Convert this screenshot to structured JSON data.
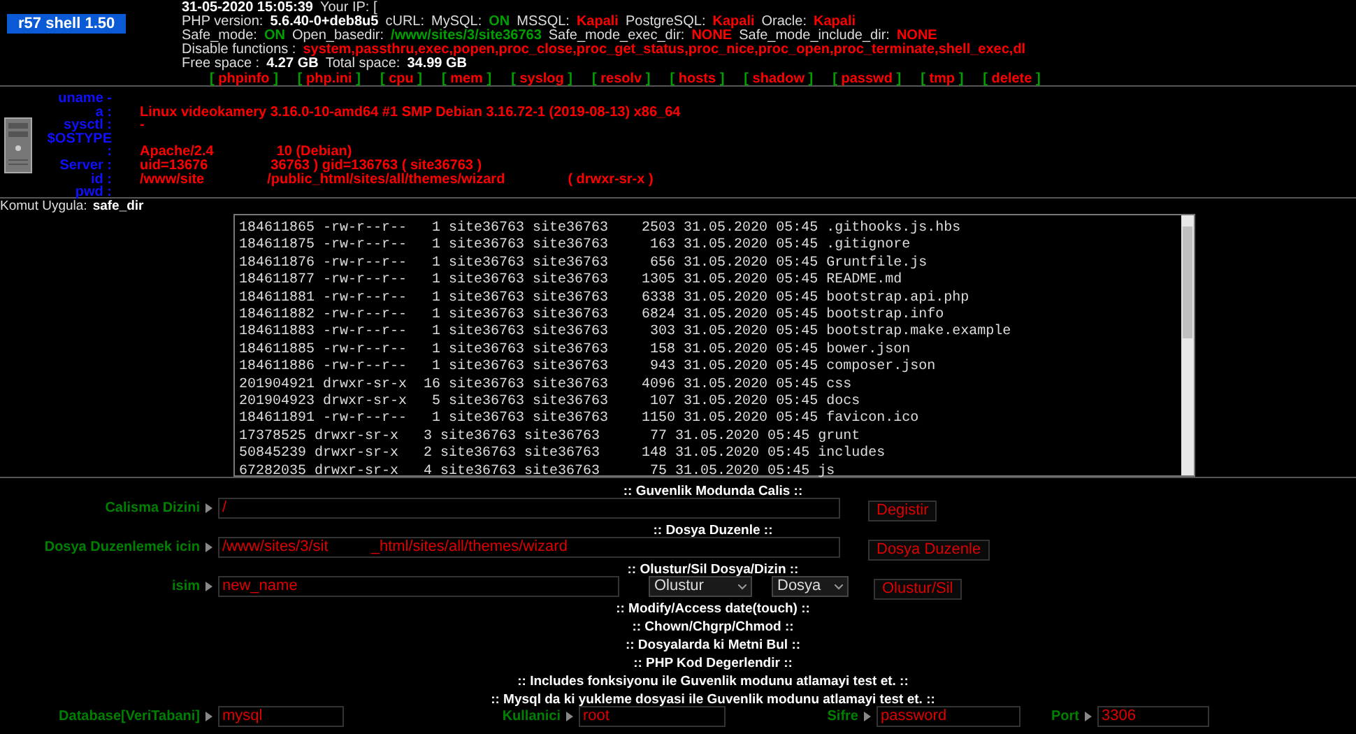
{
  "header": {
    "title": "r57 shell 1.50",
    "info_lines": [
      [
        {
          "text": "31-05-2020 15:05:39",
          "kind": "strong"
        },
        {
          "text": "Your IP: [",
          "kind": "label"
        }
      ],
      [
        {
          "text": "PHP version:",
          "kind": "label"
        },
        {
          "text": "5.6.40-0+deb8u5",
          "kind": "strong"
        },
        {
          "text": "cURL:",
          "kind": "label"
        },
        {
          "text": "MySQL:",
          "kind": "label"
        },
        {
          "text": "ON",
          "kind": "on"
        },
        {
          "text": "MSSQL:",
          "kind": "label"
        },
        {
          "text": "Kapali",
          "kind": "off"
        },
        {
          "text": "PostgreSQL:",
          "kind": "label"
        },
        {
          "text": "Kapali",
          "kind": "off"
        },
        {
          "text": "Oracle:",
          "kind": "label"
        },
        {
          "text": "Kapali",
          "kind": "off"
        }
      ],
      [
        {
          "text": "Safe_mode:",
          "kind": "label"
        },
        {
          "text": "ON",
          "kind": "on"
        },
        {
          "text": "Open_basedir:",
          "kind": "label"
        },
        {
          "text": "/www/sites/3/site36763",
          "kind": "on"
        },
        {
          "text": "Safe_mode_exec_dir:",
          "kind": "label"
        },
        {
          "text": "NONE",
          "kind": "off"
        },
        {
          "text": "Safe_mode_include_dir:",
          "kind": "label"
        },
        {
          "text": "NONE",
          "kind": "off"
        }
      ],
      [
        {
          "text": "Disable functions :",
          "kind": "label"
        },
        {
          "text": "system,passthru,exec,popen,proc_close,proc_get_status,proc_nice,proc_open,proc_terminate,shell_exec,dl",
          "kind": "off"
        }
      ],
      [
        {
          "text": "Free space :",
          "kind": "label"
        },
        {
          "text": "4.27 GB",
          "kind": "strong"
        },
        {
          "text": "Total space:",
          "kind": "label"
        },
        {
          "text": "34.99 GB",
          "kind": "strong"
        }
      ]
    ],
    "links": [
      {
        "open": "[",
        "label": "phpinfo",
        "close": "]"
      },
      {
        "open": "[",
        "label": "php.ini",
        "close": "]"
      },
      {
        "open": "[",
        "label": "cpu",
        "close": "]"
      },
      {
        "open": "[",
        "label": "mem",
        "close": "]"
      },
      {
        "open": "[",
        "label": "syslog",
        "close": "]"
      },
      {
        "open": "[",
        "label": "resolv",
        "close": "]"
      },
      {
        "open": "[",
        "label": "hosts",
        "close": "]"
      },
      {
        "open": "[",
        "label": "shadow",
        "close": "]"
      },
      {
        "open": "[",
        "label": "passwd",
        "close": "]"
      },
      {
        "open": "[",
        "label": "tmp",
        "close": "]"
      },
      {
        "open": "[",
        "label": "delete",
        "close": "]"
      }
    ]
  },
  "system_info": [
    {
      "label": "uname -"
    },
    {
      "label": "a :",
      "parts": [
        "Linux videokamery 3.16.0-10-amd64 #1 SMP Debian 3.16.72-1 (2019-08-13) x86_64"
      ]
    },
    {
      "label": "sysctl :",
      "parts": [
        "-"
      ]
    },
    {
      "label": "$OSTYPE"
    },
    {
      "label": ":",
      "parts": [
        "Apache/2.4",
        "10 (Debian)"
      ]
    },
    {
      "label": "Server :",
      "parts": [
        "uid=13676",
        "36763 ) gid=136763 ( site36763 )"
      ]
    },
    {
      "label": "id :",
      "parts": [
        "/www/site",
        "/public_html/sites/all/themes/wizard",
        "( drwxr-sr-x )"
      ]
    },
    {
      "label": "pwd :"
    }
  ],
  "command": {
    "label": "Komut Uygula:",
    "value": "safe_dir"
  },
  "listing": [
    "184611865 -rw-r--r--   1 site36763 site36763    2503 31.05.2020 05:45 .githooks.js.hbs",
    "184611875 -rw-r--r--   1 site36763 site36763     163 31.05.2020 05:45 .gitignore",
    "184611876 -rw-r--r--   1 site36763 site36763     656 31.05.2020 05:45 Gruntfile.js",
    "184611877 -rw-r--r--   1 site36763 site36763    1305 31.05.2020 05:45 README.md",
    "184611881 -rw-r--r--   1 site36763 site36763    6338 31.05.2020 05:45 bootstrap.api.php",
    "184611882 -rw-r--r--   1 site36763 site36763    6824 31.05.2020 05:45 bootstrap.info",
    "184611883 -rw-r--r--   1 site36763 site36763     303 31.05.2020 05:45 bootstrap.make.example",
    "184611885 -rw-r--r--   1 site36763 site36763     158 31.05.2020 05:45 bower.json",
    "184611886 -rw-r--r--   1 site36763 site36763     943 31.05.2020 05:45 composer.json",
    "201904921 drwxr-sr-x  16 site36763 site36763    4096 31.05.2020 05:45 css",
    "201904923 drwxr-sr-x   5 site36763 site36763     107 31.05.2020 05:45 docs",
    "184611891 -rw-r--r--   1 site36763 site36763    1150 31.05.2020 05:45 favicon.ico",
    "17378525 drwxr-sr-x   3 site36763 site36763      77 31.05.2020 05:45 grunt",
    "50845239 drwxr-sr-x   2 site36763 site36763     148 31.05.2020 05:45 includes",
    "67282035 drwxr-sr-x   4 site36763 site36763      75 31.05.2020 05:45 js"
  ],
  "sections": [
    {
      "title": ":: Guvenlik Modunda Calis ::",
      "row": {
        "kind": "path",
        "label": "Calisma Dizini",
        "value": "/",
        "button": "Degistir"
      }
    },
    {
      "title": ":: Dosya Duzenle ::",
      "row": {
        "kind": "path",
        "label": "Dosya Duzenlemek icin",
        "value": "/www/sites/3/sit          _html/sites/all/themes/wizard",
        "button": "Dosya Duzenle"
      }
    },
    {
      "title": ":: Olustur/Sil Dosya/Dizin ::",
      "row": {
        "kind": "create",
        "label": "isim",
        "value": "new_name",
        "selects": [
          "Olustur",
          "Dosya"
        ],
        "button": "Olustur/Sil"
      }
    },
    {
      "title": ":: Modify/Access date(touch) ::"
    },
    {
      "title": ":: Chown/Chgrp/Chmod ::"
    },
    {
      "title": ":: Dosyalarda ki Metni Bul ::"
    },
    {
      "title": ":: PHP Kod Degerlendir ::"
    },
    {
      "title": ":: Includes fonksiyonu ile Guvenlik modunu atlamayi test et. ::"
    },
    {
      "title": ":: Mysql da ki yukleme dosyasi ile Guvenlik modunu atlamayi test et. ::",
      "row": {
        "kind": "db",
        "fields": [
          {
            "label": "Database[VeriTabani]",
            "value": "mysql"
          },
          {
            "label": "Kullanici",
            "value": "root"
          },
          {
            "label": "Sifre",
            "value": "password"
          },
          {
            "label": "Port",
            "value": "3306"
          }
        ]
      }
    }
  ]
}
